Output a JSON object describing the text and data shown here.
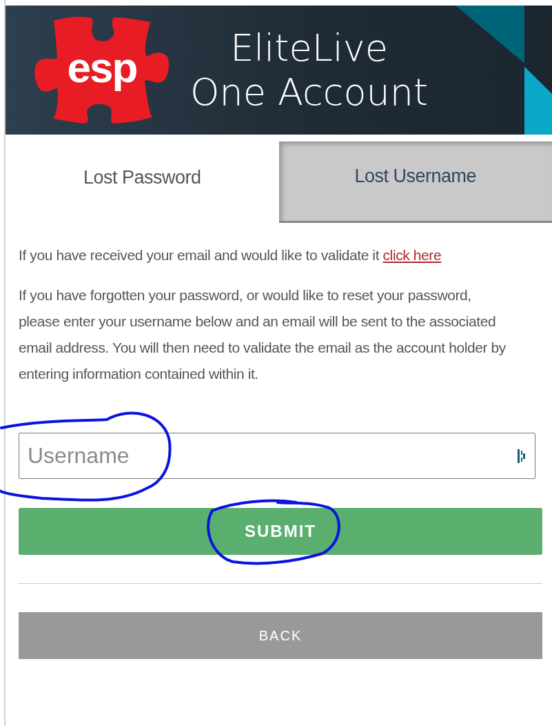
{
  "header": {
    "logo_text": "esp",
    "title_lines": [
      "EliteLive",
      "One Account"
    ]
  },
  "tabs": [
    {
      "label": "Lost Password",
      "selected": true
    },
    {
      "label": "Lost Username",
      "selected": false
    }
  ],
  "intro": {
    "text": "If you have received your email and would like to validate it",
    "link": "click here"
  },
  "description": "If you have forgotten your password, or would like to reset your password, please enter your username below and an email will be sent to the associated email address. You will then need to validate the email as the account holder by entering information contained within it.",
  "username_field": {
    "placeholder": "Username"
  },
  "buttons": [
    {
      "label": "SUBMIT",
      "kind": "primary"
    },
    {
      "label": "BACK",
      "kind": "secondary"
    }
  ],
  "annotations": [
    {
      "kind": "circle"
    },
    {
      "kind": "circle"
    }
  ]
}
